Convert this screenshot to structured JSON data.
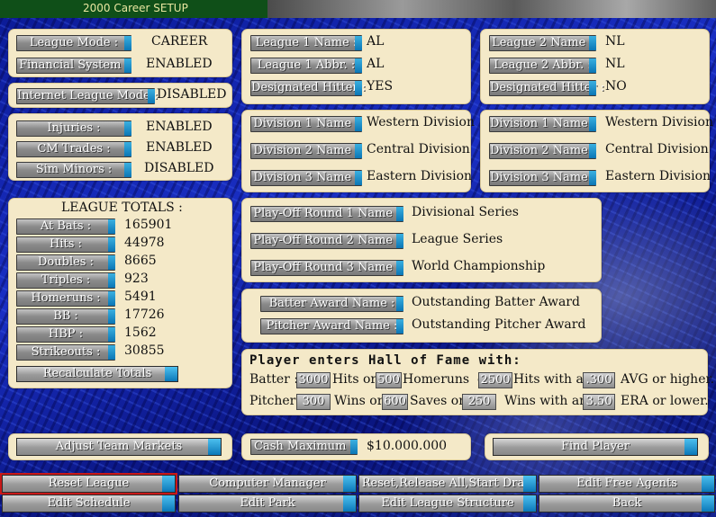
{
  "window": {
    "title": "2000 Career SETUP"
  },
  "league_settings": {
    "mode_label": "League Mode :",
    "mode_value": "CAREER",
    "financial_label": "Financial System :",
    "financial_value": "ENABLED",
    "internet_label": "Internet League Mode :",
    "internet_value": "DISABLED",
    "injuries_label": "Injuries :",
    "injuries_value": "ENABLED",
    "cm_trades_label": "CM Trades :",
    "cm_trades_value": "ENABLED",
    "sim_minors_label": "Sim Minors :",
    "sim_minors_value": "DISABLED"
  },
  "league1": {
    "name_label": "League 1 Name :",
    "name": "AL",
    "abbr_label": "League 1 Abbr. :",
    "abbr": "AL",
    "dh_label": "Designated Hitter :",
    "dh": "YES"
  },
  "league2": {
    "name_label": "League 2 Name :",
    "name": "NL",
    "abbr_label": "League 2 Abbr. :",
    "abbr": "NL",
    "dh_label": "Designated Hitter :",
    "dh": "NO"
  },
  "divisions_left": [
    {
      "label": "Division 1 Name :",
      "value": "Western Division"
    },
    {
      "label": "Division 2 Name :",
      "value": "Central Division"
    },
    {
      "label": "Division 3 Name :",
      "value": "Eastern Division"
    }
  ],
  "divisions_right": [
    {
      "label": "Division 1 Name :",
      "value": "Western Division"
    },
    {
      "label": "Division 2 Name :",
      "value": "Central Division"
    },
    {
      "label": "Division 3 Name :",
      "value": "Eastern Division"
    }
  ],
  "playoffs": [
    {
      "label": "Play-Off Round 1 Name :",
      "value": "Divisional Series"
    },
    {
      "label": "Play-Off Round 2 Name :",
      "value": "League Series"
    },
    {
      "label": "Play-Off Round 3 Name :",
      "value": "World Championship"
    }
  ],
  "awards": [
    {
      "label": "Batter Award Name :",
      "value": "Outstanding Batter Award"
    },
    {
      "label": "Pitcher Award Name :",
      "value": "Outstanding Pitcher Award"
    }
  ],
  "totals": {
    "title": "LEAGUE TOTALS :",
    "rows": [
      {
        "label": "At Bats :",
        "value": "165901"
      },
      {
        "label": "Hits :",
        "value": "44978"
      },
      {
        "label": "Doubles :",
        "value": "8665"
      },
      {
        "label": "Triples :",
        "value": "923"
      },
      {
        "label": "Homeruns :",
        "value": "5491"
      },
      {
        "label": "BB :",
        "value": "17726"
      },
      {
        "label": "HBP :",
        "value": "1562"
      },
      {
        "label": "Strikeouts :",
        "value": "30855"
      }
    ],
    "recalc_label": "Recalculate Totals"
  },
  "hof": {
    "title": "Player enters Hall of Fame with:",
    "batter_label": "Batter :",
    "batter_hits": "3000",
    "hits_or": "Hits or",
    "batter_hr": "500",
    "hr_or": "Homeruns  or",
    "batter_hits2": "2500",
    "hits_with": "Hits with an",
    "batter_avg": ".300",
    "avg_higher": "AVG or higher.",
    "pitcher_label": "Pitcher:",
    "pitcher_wins": "300",
    "wins_or": "Wins or",
    "pitcher_saves": "600",
    "saves_or": "Saves or",
    "pitcher_wins2": "250",
    "wins_with": "Wins with an",
    "pitcher_era": "3.50",
    "era_lower": "ERA or lower."
  },
  "cash": {
    "label": "Cash Maximum :",
    "value": "$10.000.000"
  },
  "buttons": {
    "adjust_markets": "Adjust Team Markets",
    "find_player": "Find Player",
    "reset_league": "Reset League",
    "computer_manager": "Computer Manager",
    "reset_release": "Reset,Release All,Start Draft",
    "edit_free_agents": "Edit Free Agents",
    "edit_schedule": "Edit Schedule",
    "edit_park": "Edit Park",
    "edit_league_structure": "Edit League Structure",
    "back": "Back"
  }
}
